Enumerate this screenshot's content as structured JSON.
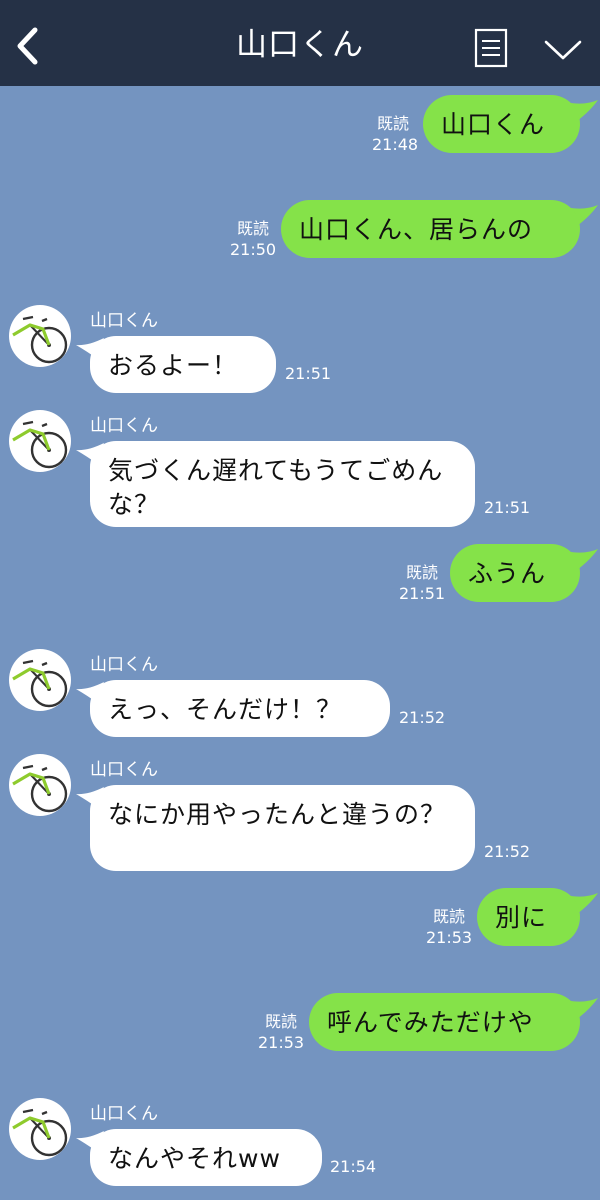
{
  "header": {
    "title": "山口くん",
    "back_icon": "chevron-left-icon",
    "menu_icon": "document-list-icon",
    "collapse_icon": "chevron-down-icon"
  },
  "colors": {
    "background": "#7494c0",
    "header": "#253146",
    "sent_bubble": "#85e249",
    "received_bubble": "#ffffff"
  },
  "read_label": "既読",
  "messages": [
    {
      "side": "sent",
      "text": "山口くん",
      "read": "既読",
      "time": "21:48"
    },
    {
      "side": "sent",
      "text": "山口くん、居らんの",
      "read": "既読",
      "time": "21:50"
    },
    {
      "side": "received",
      "sender": "山口くん",
      "text": "おるよー！",
      "time": "21:51"
    },
    {
      "side": "received",
      "sender": "山口くん",
      "text": "気づくん遅れてもうてごめんな？",
      "time": "21:51"
    },
    {
      "side": "sent",
      "text": "ふうん",
      "read": "既読",
      "time": "21:51"
    },
    {
      "side": "received",
      "sender": "山口くん",
      "text": "えっ、そんだけ！？",
      "time": "21:52"
    },
    {
      "side": "received",
      "sender": "山口くん",
      "text": "なにか用やったんと違うの？",
      "time": "21:52"
    },
    {
      "side": "sent",
      "text": "別に",
      "read": "既読",
      "time": "21:53"
    },
    {
      "side": "sent",
      "text": "呼んでみただけや",
      "read": "既読",
      "time": "21:53"
    },
    {
      "side": "received",
      "sender": "山口くん",
      "text": "なんやそれww",
      "time": "21:54"
    }
  ]
}
